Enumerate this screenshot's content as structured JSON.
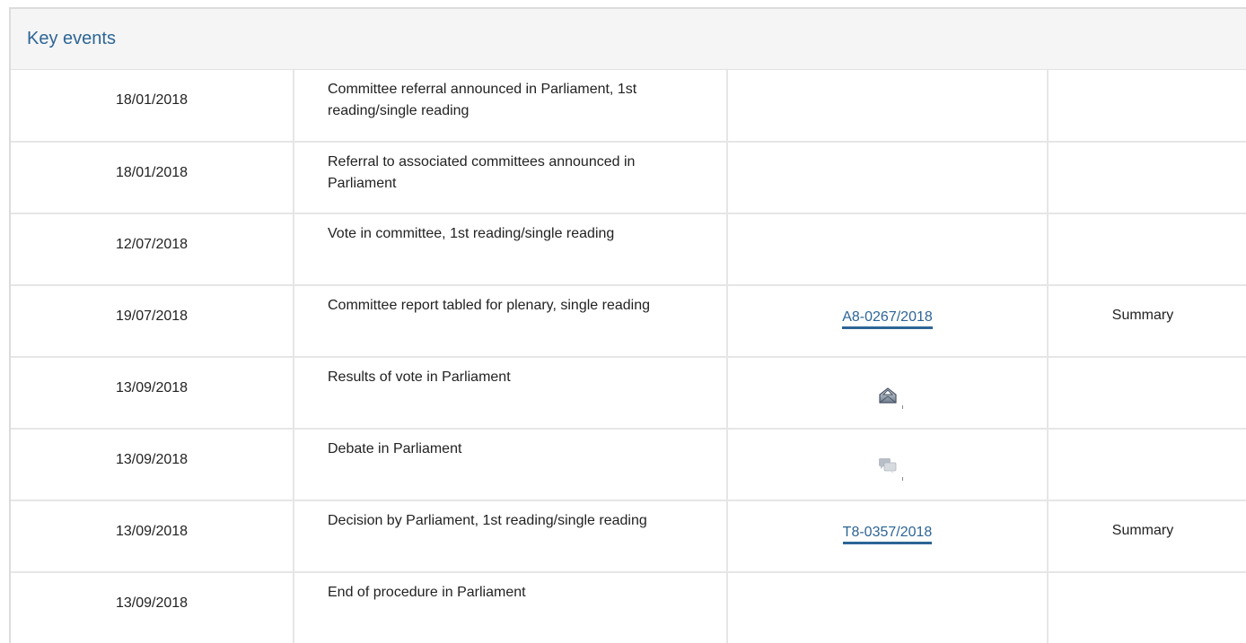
{
  "panel": {
    "title": "Key events"
  },
  "events": [
    {
      "date": "18/01/2018",
      "event": "Committee referral announced in Parliament, 1st reading/single reading",
      "document": "",
      "summary": ""
    },
    {
      "date": "18/01/2018",
      "event": "Referral to associated committees announced in Parliament",
      "document": "",
      "summary": ""
    },
    {
      "date": "12/07/2018",
      "event": "Vote in committee, 1st reading/single reading",
      "document": "",
      "summary": ""
    },
    {
      "date": "19/07/2018",
      "event": "Committee report tabled for plenary, single reading",
      "document": "A8-0267/2018",
      "summary": "Summary"
    },
    {
      "date": "13/09/2018",
      "event": "Results of vote in Parliament",
      "icon": "vote-results-icon",
      "summary": ""
    },
    {
      "date": "13/09/2018",
      "event": "Debate in Parliament",
      "icon": "debate-icon",
      "summary": ""
    },
    {
      "date": "13/09/2018",
      "event": "Decision by Parliament, 1st reading/single reading",
      "document": "T8-0357/2018",
      "summary": "Summary"
    },
    {
      "date": "13/09/2018",
      "event": "End of procedure in Parliament",
      "document": "",
      "summary": ""
    }
  ],
  "colors": {
    "title": "#2d6596",
    "link": "#2d6596",
    "header_bg": "#f5f5f5",
    "border": "#e6e6e6"
  }
}
